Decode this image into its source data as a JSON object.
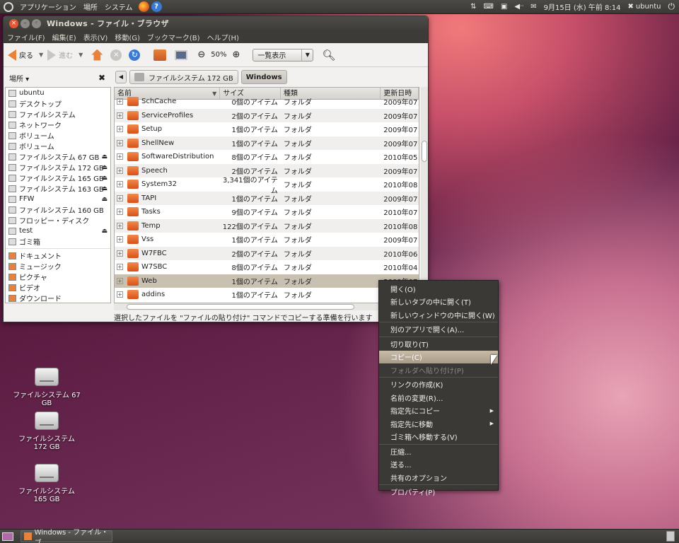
{
  "top_panel": {
    "menus": [
      "アプリケーション",
      "場所",
      "システム"
    ],
    "datetime": "9月15日 (水) 午前 8:14",
    "user": "ubuntu"
  },
  "window": {
    "title": "Windows - ファイル・ブラウザ",
    "menubar": [
      "ファイル(F)",
      "編集(E)",
      "表示(V)",
      "移動(G)",
      "ブックマーク(B)",
      "ヘルプ(H)"
    ],
    "toolbar": {
      "back_label": "戻る",
      "forward_label": "進む",
      "zoom_level": "50%",
      "view_mode": "一覧表示"
    },
    "sidebar": {
      "title": "場所 ▾",
      "items": [
        {
          "label": "ubuntu",
          "eject": false
        },
        {
          "label": "デスクトップ",
          "eject": false
        },
        {
          "label": "ファイルシステム",
          "eject": false
        },
        {
          "label": "ネットワーク",
          "eject": false
        },
        {
          "label": "ボリューム",
          "eject": false
        },
        {
          "label": "ボリューム",
          "eject": false
        },
        {
          "label": "ファイルシステム 67 GB",
          "eject": true
        },
        {
          "label": "ファイルシステム 172 GB",
          "eject": true
        },
        {
          "label": "ファイルシステム 165 GB",
          "eject": true
        },
        {
          "label": "ファイルシステム 163 GB",
          "eject": true
        },
        {
          "label": "FFW",
          "eject": true
        },
        {
          "label": "ファイルシステム 160 GB",
          "eject": false
        },
        {
          "label": "フロッピー・ディスク",
          "eject": false
        },
        {
          "label": "test",
          "eject": true
        },
        {
          "label": "ゴミ箱",
          "eject": false
        }
      ],
      "bookmarks": [
        "ドキュメント",
        "ミュージック",
        "ピクチャ",
        "ビデオ",
        "ダウンロード"
      ]
    },
    "pathbar": {
      "crumbs": [
        "ファイルシステム 172 GB",
        "Windows"
      ]
    },
    "columns": [
      "名前",
      "サイズ",
      "種類",
      "更新日時"
    ],
    "rows": [
      {
        "name": "SchCache",
        "size": "0個のアイテム",
        "type": "フォルダ",
        "date": "2009年07"
      },
      {
        "name": "ServiceProfiles",
        "size": "2個のアイテム",
        "type": "フォルダ",
        "date": "2009年07"
      },
      {
        "name": "Setup",
        "size": "1個のアイテム",
        "type": "フォルダ",
        "date": "2009年07"
      },
      {
        "name": "ShellNew",
        "size": "1個のアイテム",
        "type": "フォルダ",
        "date": "2009年07"
      },
      {
        "name": "SoftwareDistribution",
        "size": "8個のアイテム",
        "type": "フォルダ",
        "date": "2010年05"
      },
      {
        "name": "Speech",
        "size": "2個のアイテム",
        "type": "フォルダ",
        "date": "2009年07"
      },
      {
        "name": "System32",
        "size": "3,341個のアイテム",
        "type": "フォルダ",
        "date": "2010年08"
      },
      {
        "name": "TAPI",
        "size": "1個のアイテム",
        "type": "フォルダ",
        "date": "2009年07"
      },
      {
        "name": "Tasks",
        "size": "9個のアイテム",
        "type": "フォルダ",
        "date": "2010年07"
      },
      {
        "name": "Temp",
        "size": "122個のアイテム",
        "type": "フォルダ",
        "date": "2010年08"
      },
      {
        "name": "Vss",
        "size": "1個のアイテム",
        "type": "フォルダ",
        "date": "2009年07"
      },
      {
        "name": "W7FBC",
        "size": "2個のアイテム",
        "type": "フォルダ",
        "date": "2010年06"
      },
      {
        "name": "W7SBC",
        "size": "8個のアイテム",
        "type": "フォルダ",
        "date": "2010年04"
      },
      {
        "name": "Web",
        "size": "1個のアイテム",
        "type": "フォルダ",
        "date": "2009年07"
      },
      {
        "name": "addins",
        "size": "1個のアイテム",
        "type": "フォルダ",
        "date": ""
      }
    ],
    "status": "選択したファイルを \"ファイルの貼り付け\" コマンドでコピーする準備を行います"
  },
  "context_menu": [
    {
      "label": "開く(O)"
    },
    {
      "label": "新しいタブの中に開く(T)"
    },
    {
      "label": "新しいウィンドウの中に開く(W)"
    },
    {
      "sep": true
    },
    {
      "label": "別のアプリで開く(A)..."
    },
    {
      "sep": true
    },
    {
      "label": "切り取り(T)"
    },
    {
      "label": "コピー(C)",
      "selected": true
    },
    {
      "label": "フォルダへ貼り付け(P)",
      "disabled": true
    },
    {
      "sep": true
    },
    {
      "label": "リンクの作成(K)"
    },
    {
      "label": "名前の変更(R)..."
    },
    {
      "label": "指定先にコピー",
      "submenu": true
    },
    {
      "label": "指定先に移動",
      "submenu": true
    },
    {
      "label": "ゴミ箱へ移動する(V)"
    },
    {
      "sep": true
    },
    {
      "label": "圧縮..."
    },
    {
      "label": "送る..."
    },
    {
      "label": "共有のオプション"
    },
    {
      "sep": true
    },
    {
      "label": "プロパティ(P)"
    }
  ],
  "desktop_icons": [
    "ファイルシステム 67 GB",
    "ファイルシステム 172 GB",
    "ファイルシステム 165 GB"
  ],
  "taskbar": {
    "task_label": "Windows - ファイル・ブ..."
  }
}
